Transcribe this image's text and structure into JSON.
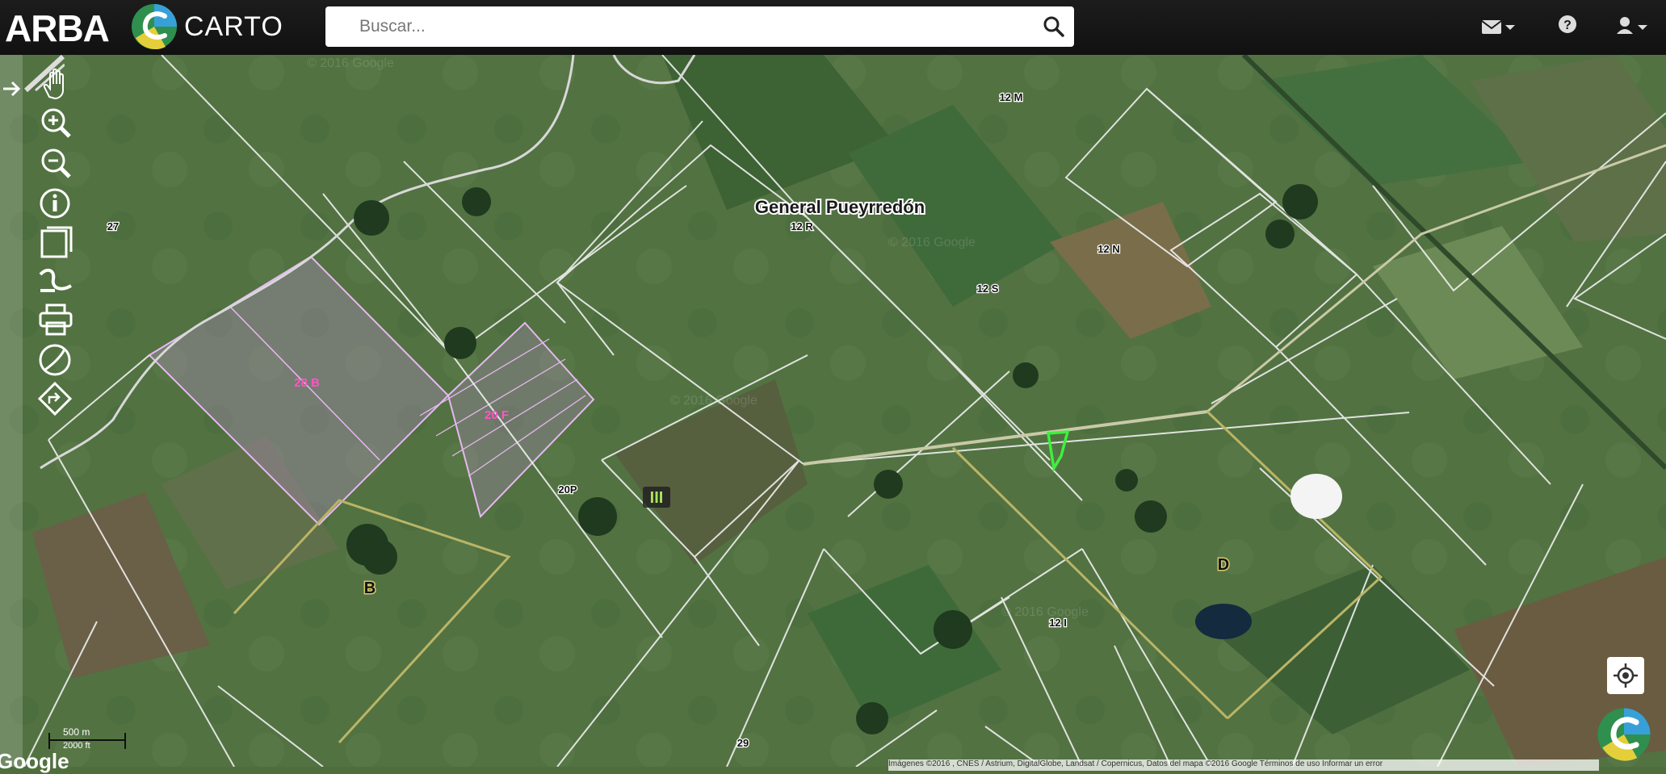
{
  "header": {
    "brand": "ARBA",
    "app_name": "CARTO",
    "search_placeholder": "Buscar...",
    "icons": [
      "envelope-icon",
      "help-icon",
      "user-icon"
    ]
  },
  "toolbar": {
    "tools": [
      "pan-hand-icon",
      "zoom-in-icon",
      "zoom-out-icon",
      "info-icon",
      "layers-icon",
      "measure-icon",
      "print-icon",
      "globe-icon",
      "directions-icon"
    ]
  },
  "map": {
    "labels": {
      "city": "General Pueyrredón",
      "p27": "27",
      "p12m": "12 M",
      "p12r": "12 R",
      "p12n": "12 N",
      "p12s": "12 S",
      "p28b": "28 B",
      "p20f": "20 F",
      "p20p": "20P",
      "roman": "III",
      "b": "B",
      "d": "D",
      "p12i": "12 I",
      "p29": "29"
    },
    "watermark": "© 2016 Google",
    "scale_m": "500 m",
    "scale_ft": "2000 ft",
    "google_logo": "Google",
    "attribution": "Imágenes ©2016 , CNES / Astrium, DigitalGlobe, Landsat / Copernicus, Datos del mapa ©2016 Google  Términos de uso  Informar un error"
  }
}
